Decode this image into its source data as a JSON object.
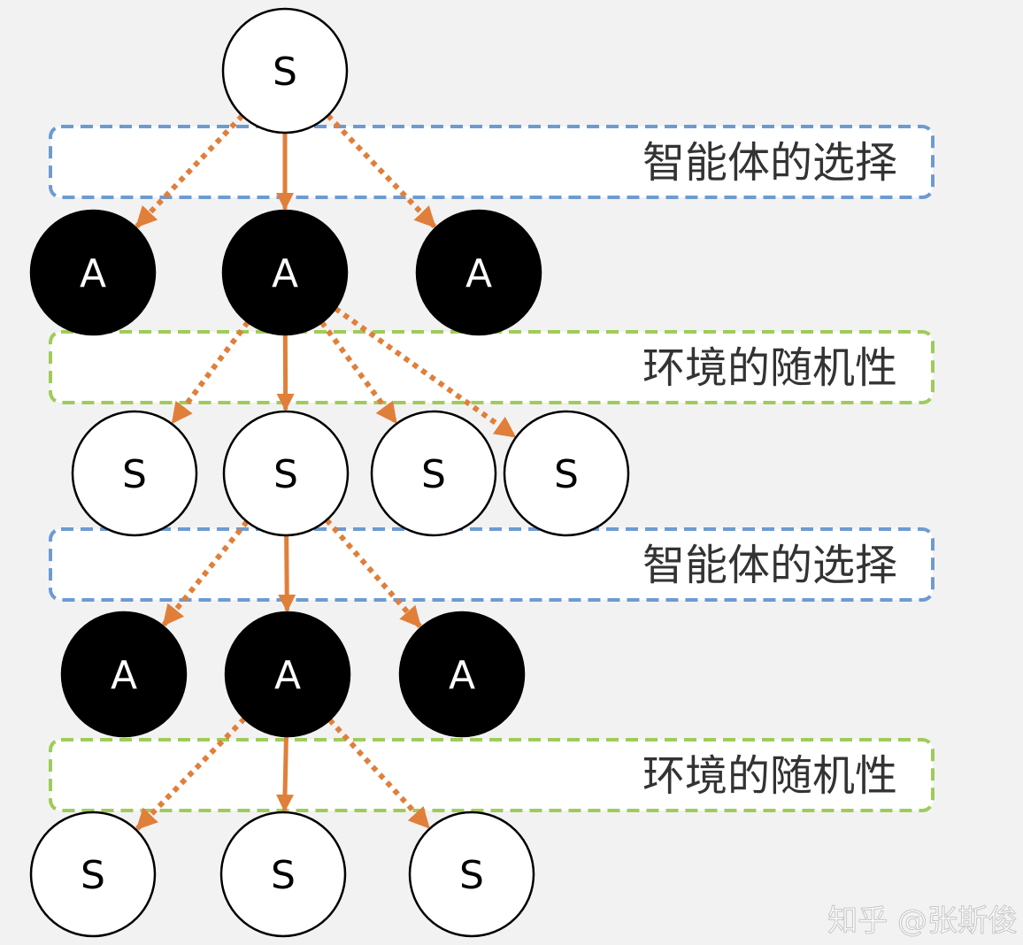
{
  "colors": {
    "background": "#f2f2f2",
    "agent_band": "#6d9bd1",
    "env_band": "#9fcb59",
    "arrow": "#e07f3a",
    "state_fill": "#ffffff",
    "action_fill": "#000000"
  },
  "bands": [
    {
      "id": "band-agent-1",
      "label": "智能体的选择",
      "kind": "agent"
    },
    {
      "id": "band-env-1",
      "label": "环境的随机性",
      "kind": "env"
    },
    {
      "id": "band-agent-2",
      "label": "智能体的选择",
      "kind": "agent"
    },
    {
      "id": "band-env-2",
      "label": "环境的随机性",
      "kind": "env"
    }
  ],
  "nodes": [
    {
      "id": "s0",
      "label": "S",
      "kind": "state"
    },
    {
      "id": "a1",
      "label": "A",
      "kind": "action"
    },
    {
      "id": "a2",
      "label": "A",
      "kind": "action"
    },
    {
      "id": "a3",
      "label": "A",
      "kind": "action"
    },
    {
      "id": "s1",
      "label": "S",
      "kind": "state"
    },
    {
      "id": "s2",
      "label": "S",
      "kind": "state"
    },
    {
      "id": "s3",
      "label": "S",
      "kind": "state"
    },
    {
      "id": "s4",
      "label": "S",
      "kind": "state"
    },
    {
      "id": "a4",
      "label": "A",
      "kind": "action"
    },
    {
      "id": "a5",
      "label": "A",
      "kind": "action"
    },
    {
      "id": "a6",
      "label": "A",
      "kind": "action"
    },
    {
      "id": "s5",
      "label": "S",
      "kind": "state"
    },
    {
      "id": "s6",
      "label": "S",
      "kind": "state"
    },
    {
      "id": "s7",
      "label": "S",
      "kind": "state"
    }
  ],
  "edges": [
    {
      "from": "s0",
      "to": "a1",
      "style": "dotted"
    },
    {
      "from": "s0",
      "to": "a2",
      "style": "solid"
    },
    {
      "from": "s0",
      "to": "a3",
      "style": "dotted"
    },
    {
      "from": "a2",
      "to": "s1",
      "style": "dotted"
    },
    {
      "from": "a2",
      "to": "s2",
      "style": "solid"
    },
    {
      "from": "a2",
      "to": "s3",
      "style": "dotted"
    },
    {
      "from": "a2",
      "to": "s4",
      "style": "dotted"
    },
    {
      "from": "s2",
      "to": "a4",
      "style": "dotted"
    },
    {
      "from": "s2",
      "to": "a5",
      "style": "solid"
    },
    {
      "from": "s2",
      "to": "a6",
      "style": "dotted"
    },
    {
      "from": "a5",
      "to": "s5",
      "style": "dotted"
    },
    {
      "from": "a5",
      "to": "s6",
      "style": "solid"
    },
    {
      "from": "a5",
      "to": "s7",
      "style": "dotted"
    }
  ],
  "watermark": "知乎 @张斯俊"
}
